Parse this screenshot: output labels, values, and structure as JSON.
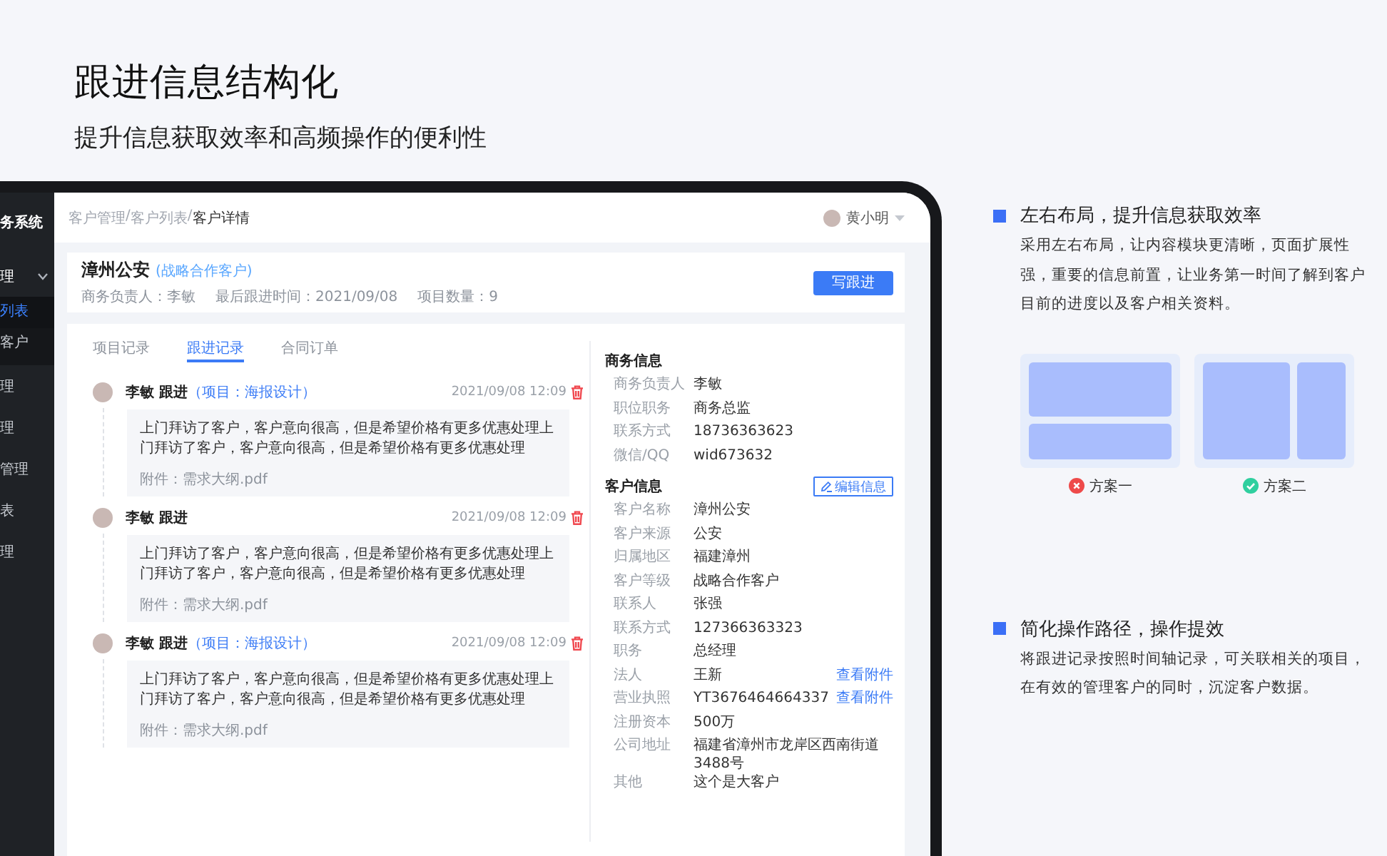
{
  "headline": "跟进信息结构化",
  "subtitle": "提升信息获取效率和高频操作的便利性",
  "app": {
    "sidebar": {
      "title": "务系统",
      "items": [
        {
          "label": "理",
          "expanded": true,
          "children": [
            {
              "label": "列表",
              "selected": true
            },
            {
              "label": "客户",
              "selected": false
            }
          ]
        },
        {
          "label": "理"
        },
        {
          "label": "理"
        },
        {
          "label": "管理"
        },
        {
          "label": "表"
        },
        {
          "label": "理"
        }
      ]
    },
    "breadcrumb": {
      "separator": "/",
      "items": [
        "客户管理",
        "客户列表",
        "客户详情"
      ]
    },
    "user": {
      "name": "黄小明"
    },
    "customer": {
      "name": "漳州公安",
      "tag": "(战略合作客户)",
      "meta": [
        "商务负责人：李敏",
        "最后跟进时间：2021/09/08",
        "项目数量：9"
      ],
      "action": "写跟进"
    },
    "tabs": [
      {
        "label": "项目记录",
        "selected": false
      },
      {
        "label": "跟进记录",
        "selected": true
      },
      {
        "label": "合同订单",
        "selected": false
      }
    ],
    "timeline": [
      {
        "author": "李敏 跟进",
        "project": "（项目：海报设计）",
        "time": "2021/09/08 12:09",
        "text": "上门拜访了客户，客户意向很高，但是希望价格有更多优惠处理上门拜访了客户，客户意向很高，但是希望价格有更多优惠处理",
        "attachment": "附件：需求大纲.pdf"
      },
      {
        "author": "李敏 跟进",
        "time": "2021/09/08 12:09",
        "text": "上门拜访了客户，客户意向很高，但是希望价格有更多优惠处理上门拜访了客户，客户意向很高，但是希望价格有更多优惠处理",
        "attachment": "附件：需求大纲.pdf"
      },
      {
        "author": "李敏 跟进",
        "project": "（项目：海报设计）",
        "time": "2021/09/08 12:09",
        "text": "上门拜访了客户，客户意向很高，但是希望价格有更多优惠处理上门拜访了客户，客户意向很高，但是希望价格有更多优惠处理",
        "attachment": "附件：需求大纲.pdf"
      }
    ],
    "info_sections": [
      {
        "title": "商务信息",
        "rows": [
          {
            "label": "商务负责人",
            "value": "李敏"
          },
          {
            "label": "职位职务",
            "value": "商务总监"
          },
          {
            "label": "联系方式",
            "value": "18736363623"
          },
          {
            "label": "微信/QQ",
            "value": "wid673632"
          }
        ]
      },
      {
        "title": "客户信息",
        "button": "编辑信息",
        "rows": [
          {
            "label": "客户名称",
            "value": "漳州公安"
          },
          {
            "label": "客户来源",
            "value": "公安"
          },
          {
            "label": "归属地区",
            "value": "福建漳州"
          },
          {
            "label": "客户等级",
            "value": "战略合作客户"
          },
          {
            "label": "联系人",
            "value": "张强"
          },
          {
            "label": "联系方式",
            "value": "127366363323"
          },
          {
            "label": "职务",
            "value": "总经理"
          },
          {
            "label": "法人",
            "value": "王新",
            "link": "查看附件"
          },
          {
            "label": "营业执照",
            "value": "YT3676464664337",
            "link": "查看附件"
          },
          {
            "label": "注册资本",
            "value": "500万"
          },
          {
            "label": "公司地址",
            "value": "福建省漳州市龙岸区西南街道3488号"
          },
          {
            "label": "其他",
            "value": "这个是大客户"
          }
        ]
      }
    ]
  },
  "features": [
    {
      "title": "左右布局，提升信息获取效率",
      "text": "采用左右布局，让内容模块更清晰，页面扩展性强，重要的信息前置，让业务第一时间了解到客户目前的进度以及客户相关资料。",
      "options": [
        {
          "label": "方案一",
          "kind": "rows",
          "recommended": false
        },
        {
          "label": "方案二",
          "kind": "columns",
          "recommended": true
        }
      ]
    },
    {
      "title": "简化操作路径，操作提效",
      "text": "将跟进记录按照时间轴记录，可关联相关的项目，在有效的管理客户的同时，沉淀客户数据。"
    }
  ]
}
